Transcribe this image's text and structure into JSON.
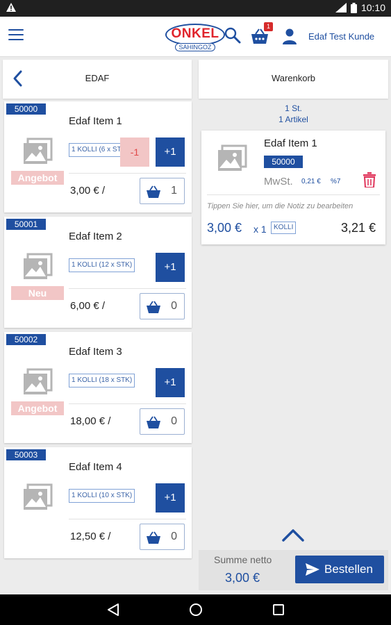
{
  "status_bar": {
    "time": "10:10",
    "icons": [
      "warning-icon",
      "signal-icon",
      "battery-icon"
    ]
  },
  "app_bar": {
    "logo_name": "ONKEL",
    "logo_sub": "SAHINGOZ",
    "cart_badge": "1",
    "user_name": "Edaf Test Kunde"
  },
  "left_pane": {
    "title": "EDAF"
  },
  "right_pane": {
    "title": "Warenkorb"
  },
  "products": [
    {
      "code": "50000",
      "name": "Edaf Item 1",
      "tag": "Angebot",
      "pack": "1 KOLLI (6 x STK)",
      "minus": "-1",
      "plus": "+1",
      "price": "3,00 € /",
      "qty": "1"
    },
    {
      "code": "50001",
      "name": "Edaf Item 2",
      "tag": "Neu",
      "pack": "1 KOLLI (12 x STK)",
      "plus": "+1",
      "price": "6,00 € /",
      "qty": "0"
    },
    {
      "code": "50002",
      "name": "Edaf Item 3",
      "tag": "Angebot",
      "pack": "1 KOLLI (18 x STK)",
      "plus": "+1",
      "price": "18,00 € /",
      "qty": "0"
    },
    {
      "code": "50003",
      "name": "Edaf Item 4",
      "pack": "1 KOLLI (10 x STK)",
      "plus": "+1",
      "price": "12,50 € /",
      "qty": "0"
    }
  ],
  "cart": {
    "summary_units": "1 St.",
    "summary_items": "1 Artikel",
    "item": {
      "name": "Edaf Item 1",
      "code": "50000",
      "mwst_label": "MwSt.",
      "tax_amount": "0,21 €",
      "tax_rate": "%7",
      "note_hint": "Tippen Sie hier, um die Notiz zu bearbeiten",
      "price": "3,00 €",
      "multiplier": "x 1",
      "unit": "KOLLI",
      "total": "3,21 €"
    }
  },
  "footer": {
    "sum_label": "Summe netto",
    "sum_value": "3,00 €",
    "order_label": "Bestellen"
  },
  "colors": {
    "primary": "#1f4fa0",
    "accent_red": "#e0242c",
    "tag_pink": "#f2c6c6"
  }
}
